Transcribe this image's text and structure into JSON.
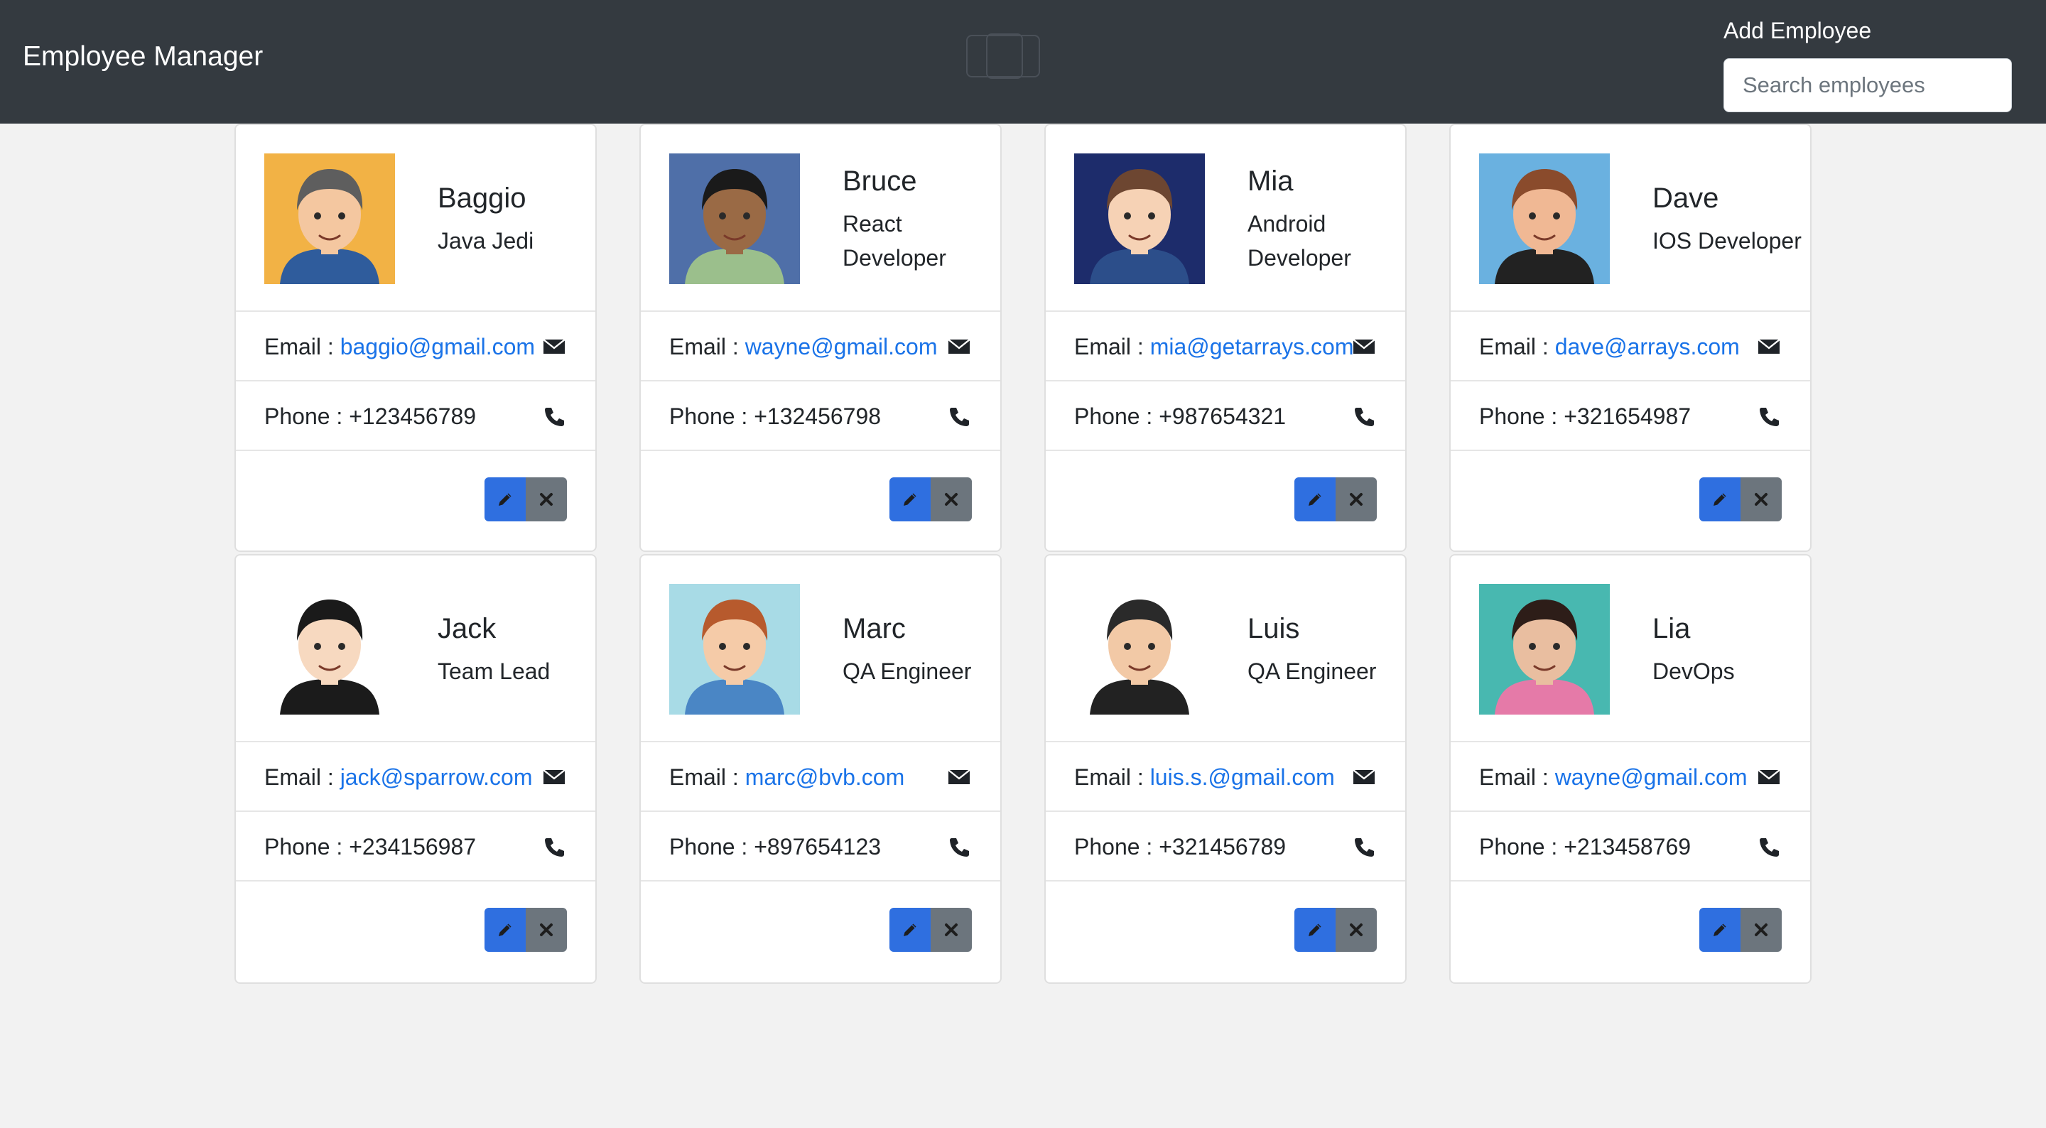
{
  "navbar": {
    "brand": "Employee Manager",
    "add_employee_label": "Add Employee",
    "search_placeholder": "Search employees"
  },
  "colors": {
    "navbar_bg": "#343a40",
    "link": "#1a73e8",
    "edit_button": "#2f6fe0",
    "delete_button": "#6c757d"
  },
  "labels": {
    "email_prefix": "Email : ",
    "phone_prefix": "Phone : "
  },
  "icons": {
    "email": "envelope-icon",
    "phone": "phone-icon",
    "edit": "pencil-icon",
    "delete": "close-icon"
  },
  "employees": [
    {
      "name": "Baggio",
      "title": "Java Jedi",
      "email": "baggio@gmail.com",
      "phone": "+123456789",
      "avatar_bg": "#f2b245",
      "shirt": "#2f5c9c",
      "skin": "#f4c7a0",
      "hair": "#5e5e5e"
    },
    {
      "name": "Bruce",
      "title": "React Developer",
      "email": "wayne@gmail.com",
      "phone": "+132456798",
      "avatar_bg": "#4f6fa8",
      "shirt": "#9bbf8c",
      "skin": "#9a6a45",
      "hair": "#1a1a1a"
    },
    {
      "name": "Mia",
      "title": "Android Developer",
      "email": "mia@getarrays.com",
      "phone": "+987654321",
      "avatar_bg": "#1d2c6b",
      "shirt": "#2c4e8a",
      "skin": "#f6d2b5",
      "hair": "#6d4631"
    },
    {
      "name": "Dave",
      "title": "IOS Developer",
      "email": "dave@arrays.com",
      "phone": "+321654987",
      "avatar_bg": "#6ab1e0",
      "shirt": "#222222",
      "skin": "#f0b894",
      "hair": "#8a4b2c"
    },
    {
      "name": "Jack",
      "title": "Team Lead",
      "email": "jack@sparrow.com",
      "phone": "+234156987",
      "avatar_bg": "#ffffff",
      "shirt": "#1b1b1b",
      "skin": "#f7d9c0",
      "hair": "#1a1a1a"
    },
    {
      "name": "Marc",
      "title": "QA Engineer",
      "email": "marc@bvb.com",
      "phone": "+897654123",
      "avatar_bg": "#a8dbe6",
      "shirt": "#4a86c5",
      "skin": "#f5cba8",
      "hair": "#b75a2d"
    },
    {
      "name": "Luis",
      "title": "QA Engineer",
      "email": "luis.s.@gmail.com",
      "phone": "+321456789",
      "avatar_bg": "#ffffff",
      "shirt": "#222222",
      "skin": "#f2c9a6",
      "hair": "#2a2a2a"
    },
    {
      "name": "Lia",
      "title": "DevOps",
      "email": "wayne@gmail.com",
      "phone": "+213458769",
      "avatar_bg": "#48b8b0",
      "shirt": "#e57aa8",
      "skin": "#e9bea0",
      "hair": "#2d1d18"
    }
  ]
}
